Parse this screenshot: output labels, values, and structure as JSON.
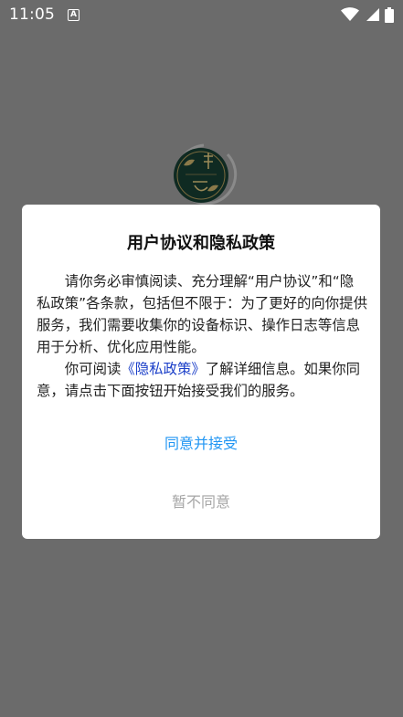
{
  "status_bar": {
    "time": "11:05",
    "notification_letter": "A",
    "icons": [
      "wifi-icon",
      "cellular-signal-icon",
      "battery-icon"
    ]
  },
  "splash": {
    "logo": "app-logo"
  },
  "dialog": {
    "title": "用户协议和隐私政策",
    "paragraph1": "请你务必审慎阅读、充分理解“用户协议”和“隐私政策”各条款，包括但不限于：为了更好的向你提供服务，我们需要收集你的设备标识、操作日志等信息用于分析、优化应用性能。",
    "paragraph2_before": "你可阅读",
    "paragraph2_link": "《隐私政策》",
    "paragraph2_after": "了解详细信息。如果你同意，请点击下面按钮开始接受我们的服务。",
    "agree_label": "同意并接受",
    "disagree_label": "暂不同意"
  },
  "colors": {
    "overlay": "#6b6b6b",
    "link": "#1a3ec8",
    "agree": "#2196f3",
    "disagree": "#a6a6a6"
  }
}
